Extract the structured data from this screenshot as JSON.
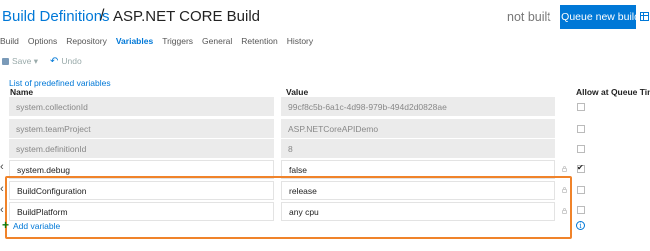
{
  "header": {
    "breadcrumb_link": "Build Definitions",
    "separator": "/",
    "definition_name": "ASP.NET CORE Build",
    "status": "not built",
    "queue_button_label": "Queue new build...",
    "accent_color": "#0078d7"
  },
  "tabs": [
    {
      "label": "Build",
      "active": false
    },
    {
      "label": "Options",
      "active": false
    },
    {
      "label": "Repository",
      "active": false
    },
    {
      "label": "Variables",
      "active": true
    },
    {
      "label": "Triggers",
      "active": false
    },
    {
      "label": "General",
      "active": false
    },
    {
      "label": "Retention",
      "active": false
    },
    {
      "label": "History",
      "active": false
    }
  ],
  "toolbar": {
    "save_label": "Save",
    "undo_label": "Undo"
  },
  "predefined_link": "List of predefined variables",
  "columns": {
    "name": "Name",
    "value": "Value",
    "allow_queue": "Allow at Queue Time"
  },
  "variables": [
    {
      "name": "system.collectionId",
      "value": "99cf8c5b-6a1c-4d98-979b-494d2d0828ae",
      "readonly": true,
      "allow_queue": false
    },
    {
      "name": "system.teamProject",
      "value": "ASP.NETCoreAPIDemo",
      "readonly": true,
      "allow_queue": false
    },
    {
      "name": "system.definitionId",
      "value": "8",
      "readonly": true,
      "allow_queue": false
    },
    {
      "name": "system.debug",
      "value": "false",
      "readonly": false,
      "allow_queue": true
    },
    {
      "name": "BuildConfiguration",
      "value": "release",
      "readonly": false,
      "allow_queue": false
    },
    {
      "name": "BuildPlatform",
      "value": "any cpu",
      "readonly": false,
      "allow_queue": false
    }
  ],
  "add_variable_label": "Add variable",
  "highlight_color": "#f0832a"
}
